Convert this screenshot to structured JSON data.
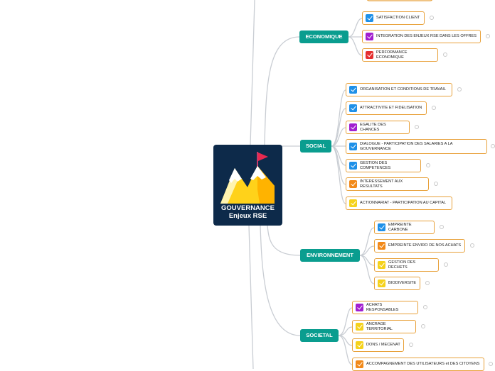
{
  "root": {
    "title_line1": "GOUVERNANCE",
    "title_line2": "Enjeux RSE",
    "icon": "mountain-flag-icon",
    "bg_color": "#0d2a4a"
  },
  "colors": {
    "category": "#0a9d8f",
    "leaf_border": "#e8a13a",
    "link": "#c9cdd3"
  },
  "categories": [
    {
      "label": "ECONOMIQUE",
      "items": [
        {
          "label": "SATISFACTION CLIENT",
          "check": "blue"
        },
        {
          "label": "INTEGRATION DES ENJEUX RSE DANS LES OFFRES",
          "check": "purple"
        },
        {
          "label": "PERFORMANCE ECONOMIQUE",
          "check": "red"
        }
      ]
    },
    {
      "label": "SOCIAL",
      "items": [
        {
          "label": "ORGANISATION ET CONDITIONS DE TRAVAIL",
          "check": "blue"
        },
        {
          "label": "ATTRACTIVITE ET FIDELISATION",
          "check": "blue"
        },
        {
          "label": "EGALITE DES CHANCES",
          "check": "purple"
        },
        {
          "label": "DIALOGUE - PARTICIPATION DES SALARIES A LA GOUVERNANCE",
          "check": "blue"
        },
        {
          "label": "GESTION DES COMPETENCES",
          "check": "blue"
        },
        {
          "label": "INTERESSEMENT AUX RESULTATS",
          "check": "orange"
        },
        {
          "label": "ACTIONNARIAT - PARTICIPATION AU CAPITAL",
          "check": "yellow"
        }
      ]
    },
    {
      "label": "ENVIRONNEMENT",
      "items": [
        {
          "label": "EMPREINTE CARBONE",
          "check": "blue"
        },
        {
          "label": "EMPREINTE ENVIRO DE NOS ACHATS",
          "check": "orange"
        },
        {
          "label": "GESTION DES DECHETS",
          "check": "yellow"
        },
        {
          "label": "BIODIVERSITE",
          "check": "yellow"
        }
      ]
    },
    {
      "label": "SOCIETAL",
      "items": [
        {
          "label": "ACHATS RESPONSABLES",
          "check": "purple"
        },
        {
          "label": "ANCRAGE TERRITORIAL",
          "check": "yellow"
        },
        {
          "label": "DONS / MECENAT",
          "check": "yellow"
        },
        {
          "label": "ACCOMPAGNEMENT DES UTILISATEURS et DES CITOYENS",
          "check": "orange"
        }
      ]
    }
  ]
}
